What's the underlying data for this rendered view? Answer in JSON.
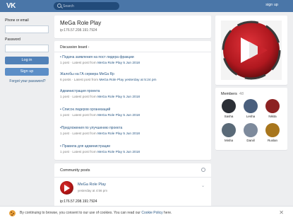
{
  "topbar": {
    "logo": "VK",
    "search_placeholder": "Search",
    "signup": "sign up"
  },
  "login": {
    "phone_label": "Phone or email",
    "password_label": "Password",
    "login_button": "Log in",
    "signup_button": "Sign up",
    "forgot": "Forgot your password?"
  },
  "group": {
    "title": "MeGa Role Play",
    "subtitle": "ip:176.57.208.191:7924"
  },
  "discussions": {
    "header": "Discussion board",
    "topics": [
      {
        "title": "• Подача заявления на пост лидера фракции",
        "meta_prefix": "1 post · Latest post from ",
        "meta_link": "MeGa Role Play 5 Jun 2018"
      },
      {
        "title": "Жалобы на ГА сервера МеGa Rp",
        "meta_prefix": "6 posts · Latest post from ",
        "meta_link": "MeGa Role Play yesterday at 5:24 pm"
      },
      {
        "title": "Администрация проекта",
        "meta_prefix": "1 post · Latest post from ",
        "meta_link": "MeGa Role Play 5 Jun 2018"
      },
      {
        "title": "• Список лидеров организаций",
        "meta_prefix": "1 post · Latest post from ",
        "meta_link": "MeGa Role Play 5 Jun 2018"
      },
      {
        "title": "•Предложения по улучшению проекта",
        "meta_prefix": "1 post · Latest post from ",
        "meta_link": "MeGa Role Play 5 Jun 2018"
      },
      {
        "title": "• Правила для администрации",
        "meta_prefix": "1 post · Latest post from ",
        "meta_link": "MeGa Role Play 5 Jun 2018"
      }
    ]
  },
  "posts": {
    "header": "Community posts",
    "author": "MeGa Role Play",
    "date": "yesterday at 4:56 pm",
    "text": "ip:176.57.208.191:7924"
  },
  "members": {
    "header": "Members",
    "count": "48",
    "list": [
      {
        "name": "Sasha",
        "color": "#2b2f36"
      },
      {
        "name": "Lesha",
        "color": "#4a5f7d"
      },
      {
        "name": "Nikita",
        "color": "#8c2222"
      },
      {
        "name": "Misha",
        "color": "#5a6a78"
      },
      {
        "name": "Daniil",
        "color": "#7d8a9c"
      },
      {
        "name": "Ruslan",
        "color": "#a8761d"
      }
    ]
  },
  "cookie": {
    "text": "By continuing to browse, you consent to our use of cookies. You can read our ",
    "link": "Cookie Policy",
    "tail": " here."
  },
  "colors": {
    "brand": "#4a76a8",
    "link": "#2a5885",
    "accent_red": "#c8242c"
  }
}
